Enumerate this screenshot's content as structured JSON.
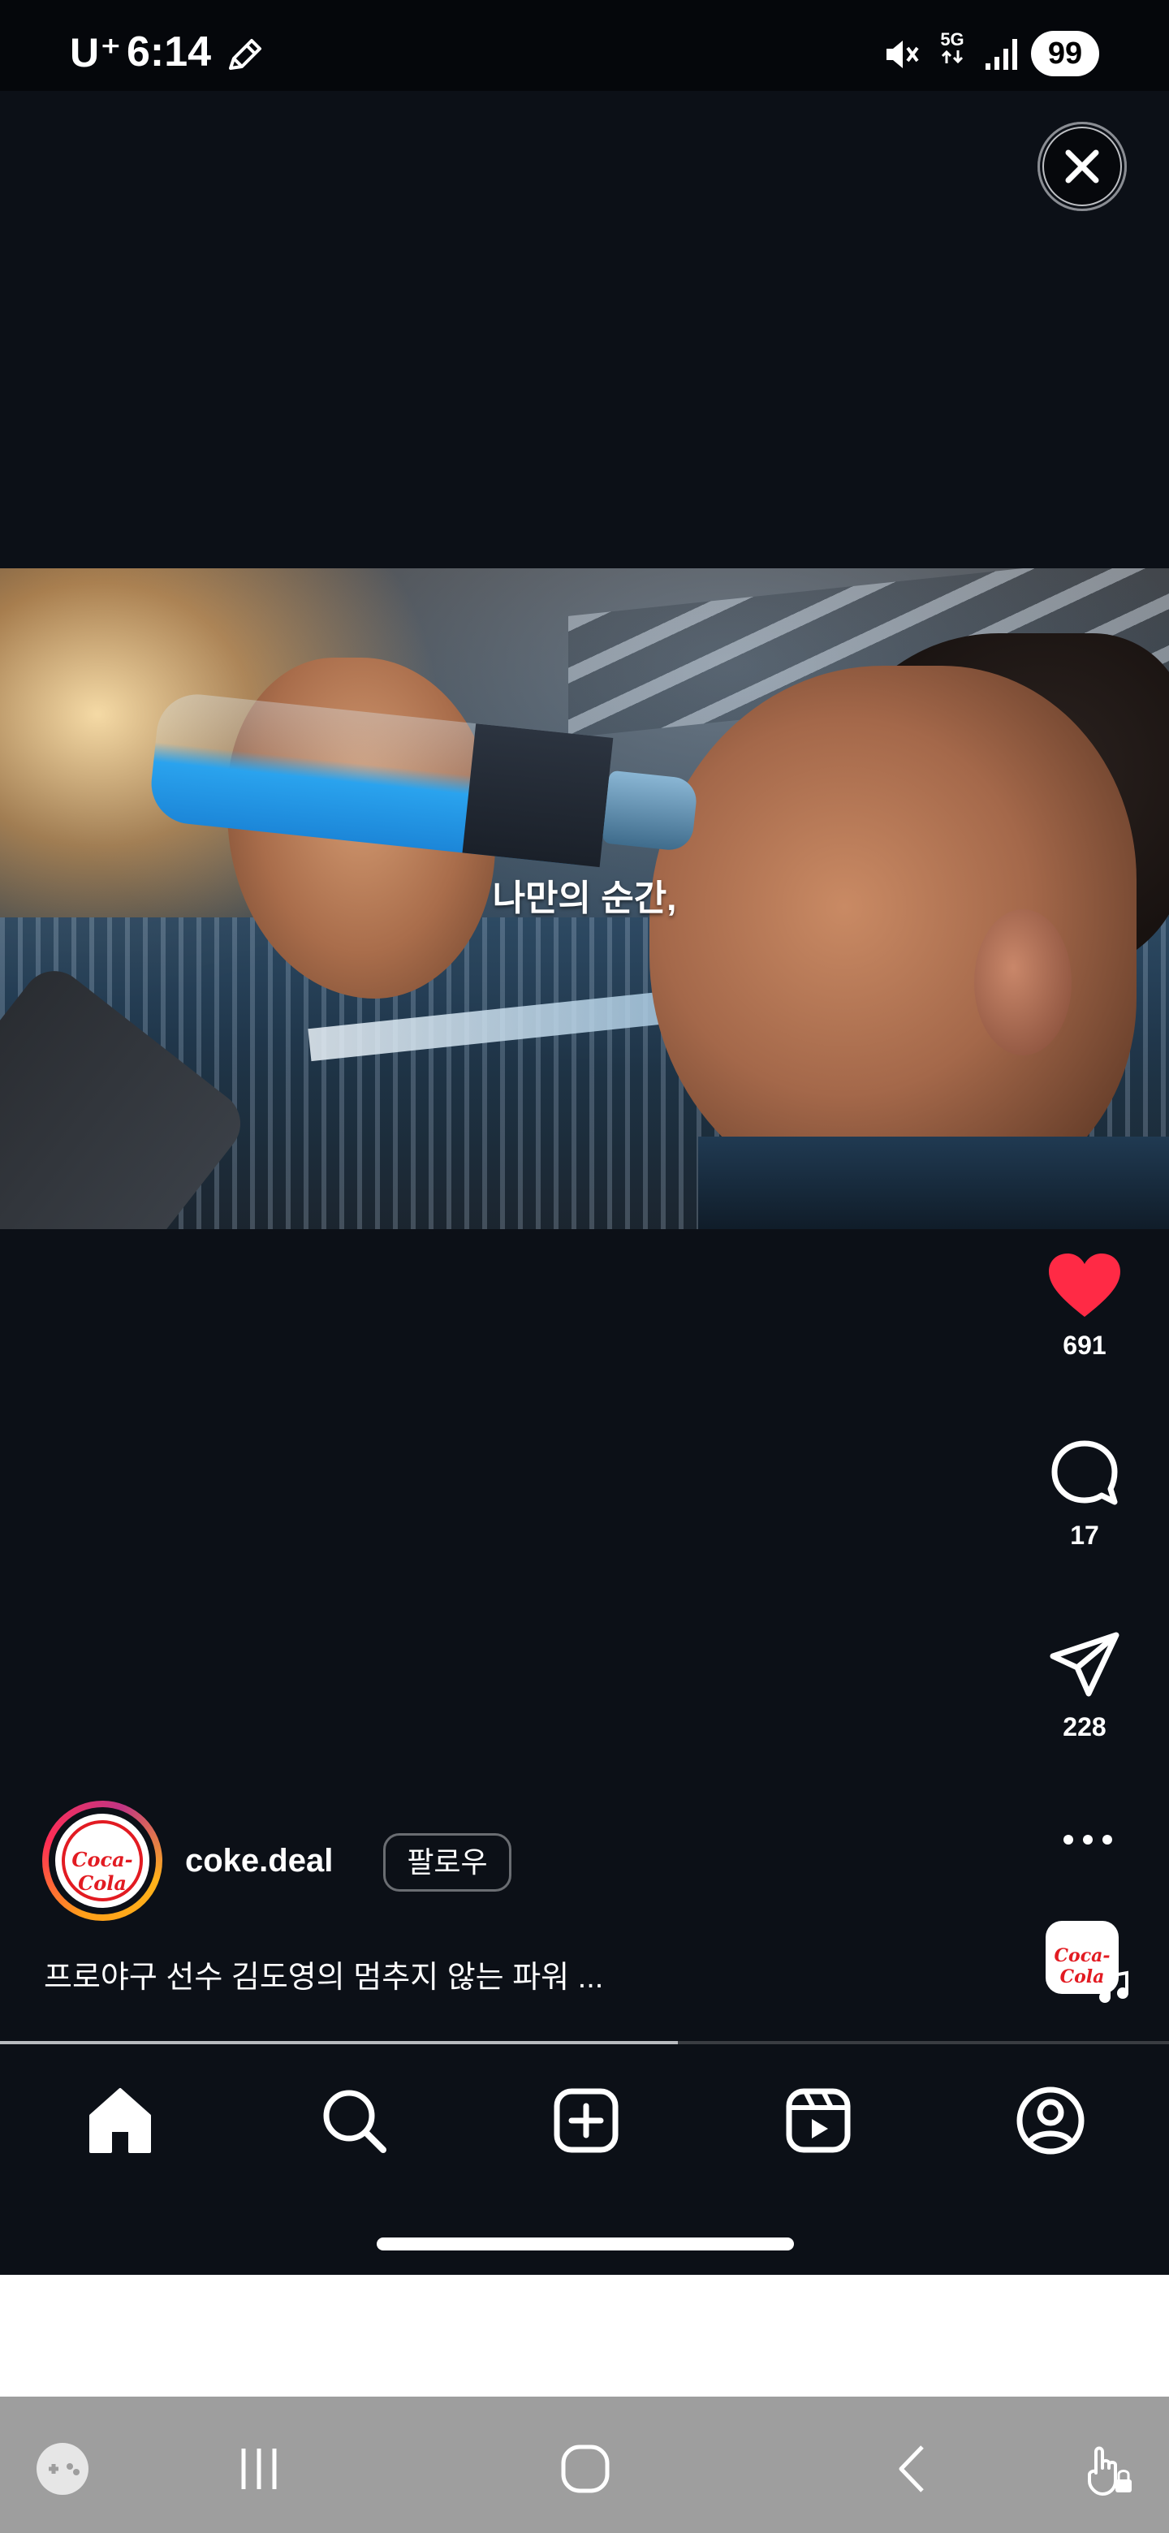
{
  "status_bar": {
    "carrier": "U⁺",
    "time": "6:14",
    "network": "5G",
    "battery": "99",
    "icons": [
      "pencil-icon",
      "mute-icon",
      "signal-icon"
    ]
  },
  "overlay": {
    "close_icon": "close-icon"
  },
  "video": {
    "subtitle": "나만의 순간,"
  },
  "actions": {
    "likes": "691",
    "comments": "17",
    "shares": "228",
    "like_color": "#ff2a45"
  },
  "post": {
    "username": "coke.deal",
    "follow_label": "팔로우",
    "caption": "프로야구 선수 김도영의 멈추지 않는 파워 ...",
    "avatar_brand": "Coca-Cola"
  },
  "progress": {
    "fraction": 0.58
  },
  "nav": {
    "items": [
      "home-icon",
      "search-icon",
      "create-icon",
      "reels-icon",
      "profile-icon"
    ]
  },
  "system_nav": {
    "items": [
      "gamepad-icon",
      "recent-apps-icon",
      "home-button-icon",
      "back-icon",
      "touch-lock-icon"
    ]
  },
  "colors": {
    "background": "#0c1017",
    "accent_like": "#ff2a45",
    "system_nav": "#9e9e9e"
  }
}
